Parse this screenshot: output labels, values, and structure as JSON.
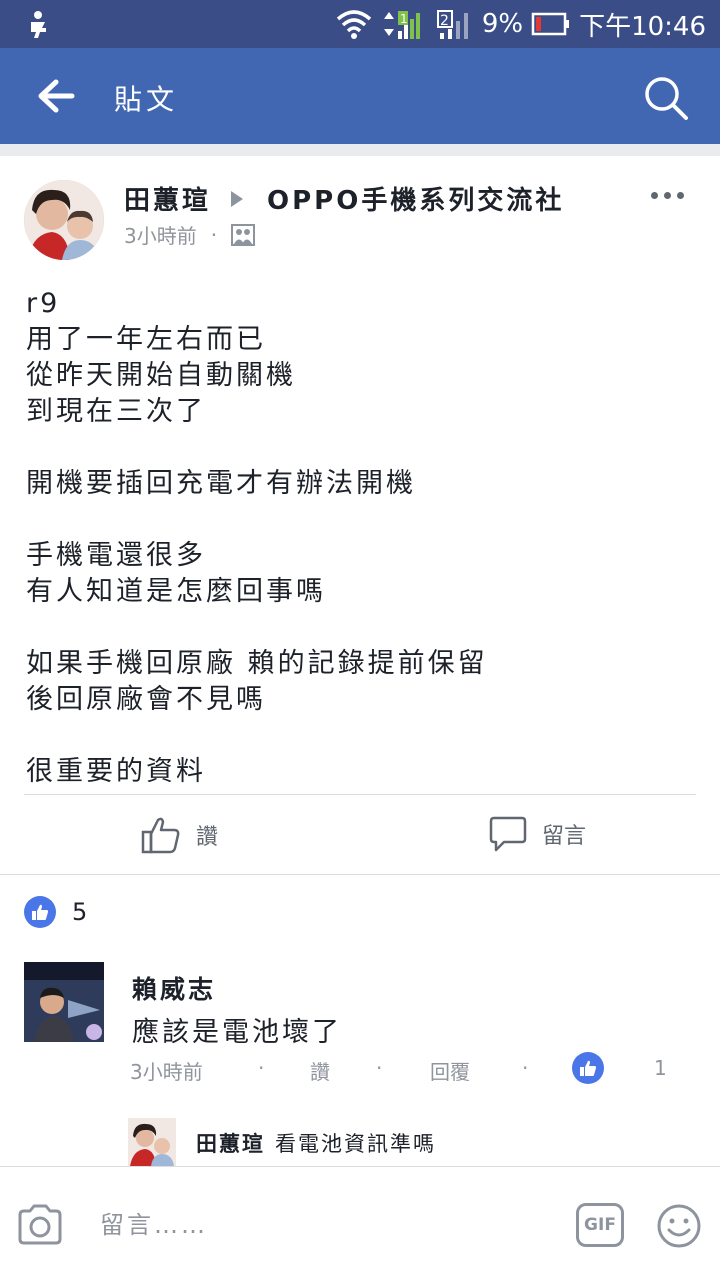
{
  "status_bar": {
    "battery": "9%",
    "time": "下午10:46",
    "sim": "2"
  },
  "app_bar": {
    "title": "貼文"
  },
  "post": {
    "author": "田蕙瑄",
    "group": "OPPO手機系列交流社",
    "time": "3小時前",
    "lines": [
      "r9",
      "用了一年左右而已",
      "從昨天開始自動關機",
      "到現在三次了",
      "",
      "開機要插回充電才有辦法開機",
      "",
      "手機電還很多",
      "有人知道是怎麼回事嗎",
      "",
      "如果手機回原廠 賴的記錄提前保留",
      "後回原廠會不見嗎",
      "",
      "很重要的資料"
    ],
    "like_label": "讚",
    "comment_label": "留言"
  },
  "reactions": {
    "count": "5"
  },
  "comment": {
    "name": "賴威志",
    "text": "應該是電池壞了",
    "time": "3小時前",
    "like_label": "讚",
    "reply_label": "回覆",
    "like_count": "1"
  },
  "reply_preview": {
    "name": "田蕙瑄",
    "text": "看電池資訊準嗎"
  },
  "composer": {
    "placeholder": "留言……",
    "gif_label": "GIF"
  },
  "colors": {
    "status_bar": "#3a4d86",
    "app_bar": "#4267b2",
    "like_blue": "#4a76e8",
    "meta_gray": "#90949c"
  }
}
